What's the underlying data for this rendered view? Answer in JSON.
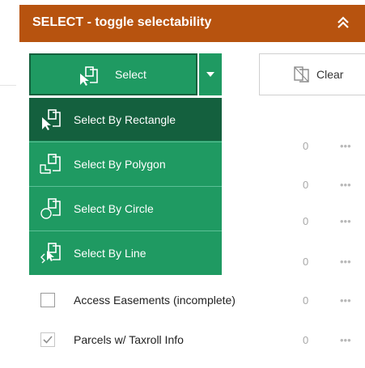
{
  "panel": {
    "title": "SELECT - toggle selectability"
  },
  "toolbar": {
    "select_label": "Select",
    "clear_label": "Clear"
  },
  "select_menu": {
    "items": [
      {
        "label": "Select By Rectangle",
        "icon": "select-rectangle-icon",
        "active": true
      },
      {
        "label": "Select By Polygon",
        "icon": "select-polygon-icon",
        "active": false
      },
      {
        "label": "Select By Circle",
        "icon": "select-circle-icon",
        "active": false
      },
      {
        "label": "Select By Line",
        "icon": "select-line-icon",
        "active": false
      }
    ]
  },
  "layers": {
    "hidden_rows": [
      {
        "count": "0",
        "more": "•••"
      },
      {
        "count": "0",
        "more": "•••"
      },
      {
        "count": "0",
        "more": "•••"
      },
      {
        "count": "0",
        "more": "•••"
      }
    ],
    "rows": [
      {
        "label": "Access Easements (incomplete)",
        "checked": false,
        "count": "0",
        "more": "•••"
      },
      {
        "label": "Parcels w/ Taxroll Info",
        "checked": true,
        "count": "0",
        "more": "•••"
      }
    ]
  },
  "colors": {
    "header": "#b7530f",
    "button_green": "#1f9a62",
    "active_green": "#14603e"
  }
}
